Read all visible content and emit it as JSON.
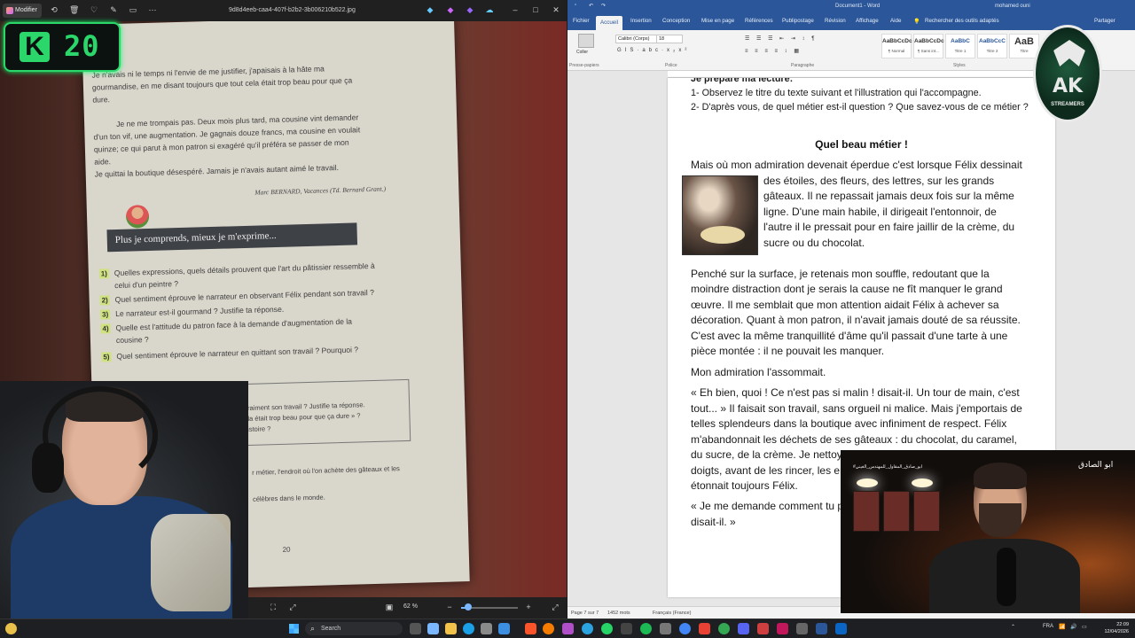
{
  "viewer": {
    "modify_label": "Modifier",
    "file_name": "9d8d4eeb-caa4-407f-b2b2-3b006210b522.jpg",
    "zoom_label": "62 %"
  },
  "badge": {
    "letter": "K",
    "number": "20"
  },
  "book_page": {
    "lines": [
      "Je n'avais ni le temps ni l'envie de me justifier, j'apaisais à la hâte ma",
      "gourmandise, en me disant toujours que tout cela était trop beau pour que ça",
      "dure.",
      "Je ne me trompais pas. Deux mois plus tard, ma cousine vint demander",
      "d'un ton vif, une augmentation. Je gagnais douze francs, ma cousine en voulait",
      "quinze; ce qui parut à mon patron si exagéré qu'il préféra se passer de mon",
      "aide.",
      "Je quittai la boutique désespéré. Jamais je n'avais autant aimé le travail."
    ],
    "attribution": "Marc BERNARD, Vacances (Td. Bernard Grant.)",
    "banner": "Plus je comprends, mieux je m'exprime...",
    "questions": [
      {
        "num": "1)",
        "text": "Quelles expressions, quels détails prouvent que l'art du pâtissier ressemble à"
      },
      {
        "num": "",
        "text": "celui d'un peintre ?"
      },
      {
        "num": "2)",
        "text": "Quel sentiment éprouve le narrateur en observant Félix pendant son travail ?"
      },
      {
        "num": "3)",
        "text": "Le narrateur est-il gourmand ? Justifie ta réponse."
      },
      {
        "num": "4)",
        "text": "Quelle est l'attitude du patron face à la demande d'augmentation de la"
      },
      {
        "num": "",
        "text": "cousine ?"
      },
      {
        "num": "5)",
        "text": "Quel sentiment éprouve le narrateur en quittant son travail ? Pourquoi ?"
      }
    ],
    "box_lines": [
      "t vraiment son travail ? Justifie ta réponse.",
      "cela était trop beau pour que ça dure » ?",
      "l'histoire ?"
    ],
    "footer_lines": [
      "r métier, l'endroit où l'on achète des gâteaux et les",
      "célèbres dans le monde."
    ],
    "page_number": "20"
  },
  "word": {
    "title": "Document1 - Word",
    "user": "mohamed ouni",
    "tabs": [
      "Fichier",
      "Accueil",
      "Insertion",
      "Conception",
      "Mise en page",
      "Références",
      "Publipostage",
      "Révision",
      "Affichage",
      "Aide",
      "Rechercher des outils adaptés"
    ],
    "share_label": "Partager",
    "font_name": "Calibri (Corps)",
    "font_size": "18",
    "paste_label": "Coller",
    "group_labels": [
      "Presse-papiers",
      "Police",
      "Paragraphe",
      "Styles"
    ],
    "styles": [
      {
        "sample": "AaBbCcDc",
        "name": "¶ Normal"
      },
      {
        "sample": "AaBbCcDc",
        "name": "¶ Sans int..."
      },
      {
        "sample": "AaBbC",
        "name": "Titre 1"
      },
      {
        "sample": "AaBbCcC",
        "name": "Titre 2"
      },
      {
        "sample": "AaB",
        "name": "Titre"
      }
    ],
    "doc": {
      "cut_line": "Je prépare ma lecture:",
      "prompts": [
        "1- Observez le titre du texte suivant et l'illustration qui l'accompagne.",
        "2- D'après vous, de quel métier est-il question ? Que savez-vous de ce métier ?"
      ],
      "title": "Quel beau métier !",
      "para1": [
        "Mais où mon admiration devenait éperdue c'est lorsque Félix dessinait",
        "des étoiles, des fleurs, des lettres, sur les grands",
        "gâteaux. Il ne repassait jamais deux fois sur la même",
        "ligne. D'une main habile, il dirigeait l'entonnoir, de",
        "l'autre il le pressait pour en faire jaillir de la crème, du",
        "sucre ou du chocolat."
      ],
      "para2": [
        "Penché sur la surface, je retenais mon souffle, redoutant que la",
        "moindre distraction dont je serais la cause ne fît manquer le grand",
        "œuvre. Il me semblait que mon attention aidait Félix à achever sa",
        "décoration. Quant à mon patron, il n'avait jamais douté de sa réussite.",
        "C'est avec la même tranquillité d'âme qu'il passait d'une tarte à une",
        "pièce montée : il ne pouvait les manquer."
      ],
      "para3": "Mon admiration l'assommait.",
      "para4": [
        "« Eh bien, quoi ! Ce n'est pas si malin ! disait-il. Un tour de main, c'est",
        "tout... » Il faisait son travail, sans orgueil ni malice. Mais j'emportais de",
        "telles splendeurs dans la boutique avec infiniment de respect. Félix",
        "m'abandonnait les déchets de ses gâteaux : du chocolat, du caramel,",
        "du sucre, de la crème. Je nettoya",
        "doigts, avant de les rincer, les ent",
        "étonnait toujours Félix."
      ],
      "para5": [
        "« Je me demande comment tu pe",
        "disait-il. »"
      ]
    },
    "status": {
      "page": "Page 7 sur 7",
      "words": "1452 mots",
      "language": "Français (France)"
    }
  },
  "logo": {
    "text": "AK",
    "sub": "STREAMERS"
  },
  "cam_right": {
    "sign": "ابو الصادق",
    "overlay": "#ابو_صادق_المقاول_للمهندس_الغيني"
  },
  "taskbar": {
    "search_placeholder": "Search",
    "lang": "FRA",
    "time": "22:09",
    "date": "12/04/2026"
  }
}
